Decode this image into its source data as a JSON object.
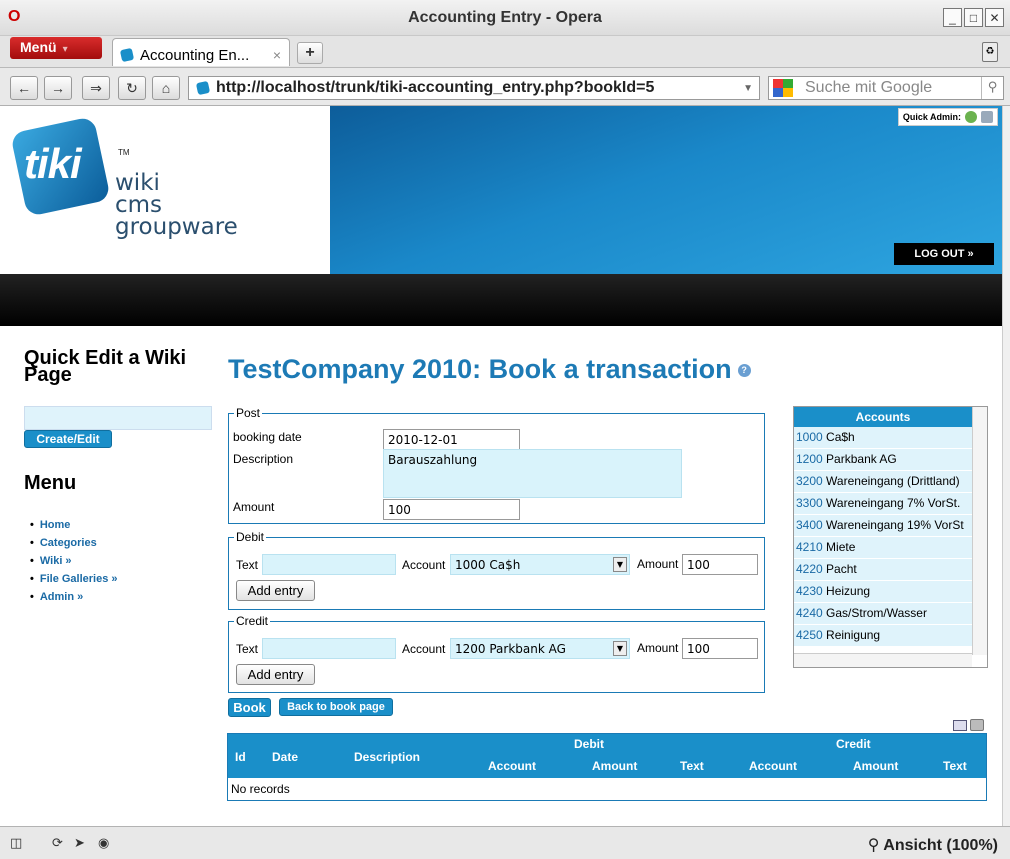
{
  "browser": {
    "window_title": "Accounting Entry - Opera",
    "menu_label": "Menü",
    "tab_title": "Accounting En...",
    "url": "http://localhost/trunk/tiki-accounting_entry.php?bookId=5",
    "search_placeholder": "Suche mit Google",
    "zoom_label": "Ansicht (100%)"
  },
  "header": {
    "quick_admin": "Quick Admin:",
    "logout": "LOG OUT »",
    "logo": {
      "mark": "tiki",
      "tm": "TM",
      "line1": "wiki",
      "line2": "cms",
      "line3": "groupware"
    }
  },
  "sidebar": {
    "quick_edit_title": "Quick Edit a Wiki Page",
    "create_edit": "Create/Edit",
    "menu_title": "Menu",
    "menu_items": [
      "Home",
      "Categories",
      "Wiki »",
      "File Galleries »",
      "Admin »"
    ]
  },
  "main": {
    "title": "TestCompany 2010: Book a transaction",
    "post": {
      "legend": "Post",
      "booking_date_label": "booking date",
      "booking_date": "2010-12-01",
      "description_label": "Description",
      "description": "Barauszahlung",
      "amount_label": "Amount",
      "amount": "100"
    },
    "debit": {
      "legend": "Debit",
      "text_label": "Text",
      "account_label": "Account",
      "account": "1000 Ca$h",
      "amount_label": "Amount",
      "amount": "100",
      "add_entry": "Add entry"
    },
    "credit": {
      "legend": "Credit",
      "text_label": "Text",
      "account_label": "Account",
      "account": "1200 Parkbank AG",
      "amount_label": "Amount",
      "amount": "100",
      "add_entry": "Add entry"
    },
    "book_button": "Book",
    "back_button": "Back to book page"
  },
  "accounts": {
    "header": "Accounts",
    "rows": [
      {
        "num": "1000",
        "name": "Ca$h"
      },
      {
        "num": "1200",
        "name": "Parkbank AG"
      },
      {
        "num": "3200",
        "name": "Wareneingang (Drittland)"
      },
      {
        "num": "3300",
        "name": "Wareneingang 7% VorSt."
      },
      {
        "num": "3400",
        "name": "Wareneingang 19% VorSt"
      },
      {
        "num": "4210",
        "name": "Miete"
      },
      {
        "num": "4220",
        "name": "Pacht"
      },
      {
        "num": "4230",
        "name": "Heizung"
      },
      {
        "num": "4240",
        "name": "Gas/Strom/Wasser"
      },
      {
        "num": "4250",
        "name": "Reinigung"
      }
    ]
  },
  "table": {
    "col_id": "Id",
    "col_date": "Date",
    "col_description": "Description",
    "group_debit": "Debit",
    "group_credit": "Credit",
    "debit_account": "Account",
    "debit_amount": "Amount",
    "debit_text": "Text",
    "credit_account": "Account",
    "credit_amount": "Amount",
    "credit_text": "Text",
    "empty": "No records"
  }
}
